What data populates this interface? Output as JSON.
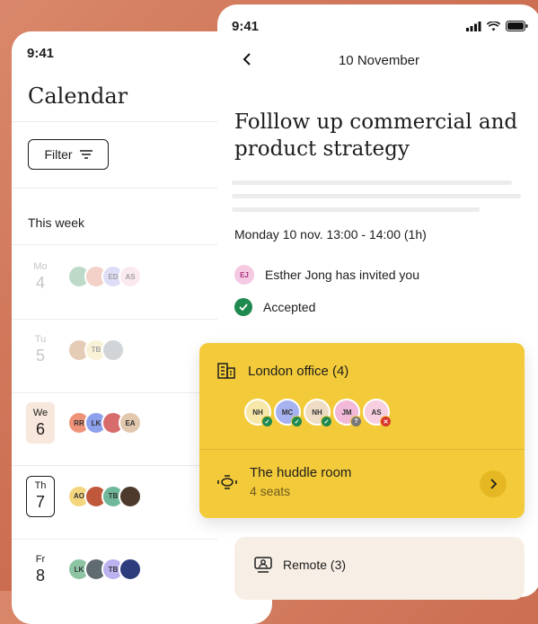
{
  "left_phone": {
    "time": "9:41",
    "title": "Calendar",
    "filter_label": "Filter",
    "week_label": "This week",
    "days": [
      {
        "abbr": "Mo",
        "num": "4",
        "muted": true,
        "style": "",
        "avatars": [
          {
            "label": "",
            "color": "#6fae86"
          },
          {
            "label": "",
            "color": "#e79b86"
          },
          {
            "label": "ED",
            "color": "#b7b4ee"
          },
          {
            "label": "AS",
            "color": "#f7cfe0"
          }
        ]
      },
      {
        "abbr": "Tu",
        "num": "5",
        "muted": true,
        "style": "",
        "avatars": [
          {
            "label": "",
            "color": "#c58f61"
          },
          {
            "label": "TB",
            "color": "#f3e3a6"
          },
          {
            "label": "",
            "color": "#9ba4a8"
          }
        ]
      },
      {
        "abbr": "We",
        "num": "6",
        "muted": false,
        "style": "today",
        "avatars": [
          {
            "label": "RR",
            "color": "#ef927a"
          },
          {
            "label": "LK",
            "color": "#8da0ec"
          },
          {
            "label": "",
            "color": "#d86b6b"
          },
          {
            "label": "EA",
            "color": "#e2c8ae"
          }
        ]
      },
      {
        "abbr": "Th",
        "num": "7",
        "muted": false,
        "style": "sel",
        "avatars": [
          {
            "label": "AO",
            "color": "#f3d67e"
          },
          {
            "label": "",
            "color": "#c0583b"
          },
          {
            "label": "TB",
            "color": "#6fb89a"
          },
          {
            "label": "",
            "color": "#4e3a2c"
          }
        ]
      },
      {
        "abbr": "Fr",
        "num": "8",
        "muted": false,
        "style": "",
        "avatars": [
          {
            "label": "LK",
            "color": "#8cc4a4"
          },
          {
            "label": "",
            "color": "#5f6b70"
          },
          {
            "label": "TB",
            "color": "#bbb2ef"
          },
          {
            "label": "",
            "color": "#2c3c7c"
          }
        ]
      }
    ]
  },
  "right_phone": {
    "time": "9:41",
    "date": "10 November",
    "title": "Folllow up commercial and product strategy",
    "time_range": "Monday 10 nov. 13:00 - 14:00 (1h)",
    "inviter_initials": "EJ",
    "invite_text": "Esther Jong has invited you",
    "status_text": "Accepted",
    "office": {
      "label": "London office (4)",
      "attendees": [
        {
          "label": "NH",
          "color": "#f7e7a8",
          "status": "accepted"
        },
        {
          "label": "MC",
          "color": "#a7b3f0",
          "status": "accepted"
        },
        {
          "label": "NH",
          "color": "#efdcc4",
          "status": "accepted"
        },
        {
          "label": "JM",
          "color": "#f1b8d8",
          "status": "unknown"
        },
        {
          "label": "AS",
          "color": "#f7cfe0",
          "status": "declined"
        }
      ],
      "room_name": "The huddle room",
      "room_seats": "4 seats"
    },
    "remote_label": "Remote (3)"
  },
  "colors": {
    "accent_yellow": "#f3cb3a",
    "accepted_green": "#1f8a4f",
    "declined_red": "#d9342b",
    "unknown_gray": "#777777"
  }
}
